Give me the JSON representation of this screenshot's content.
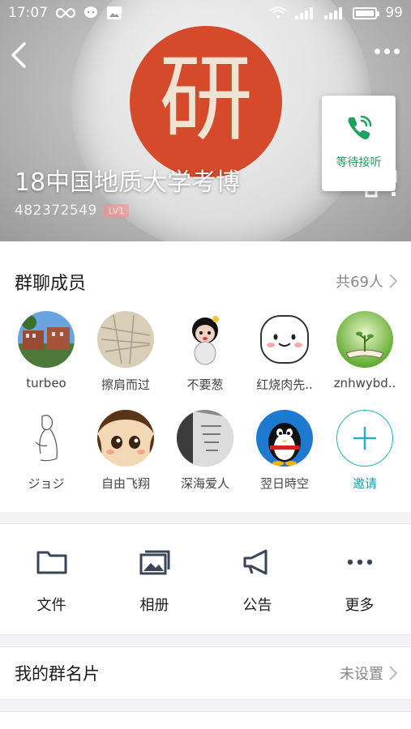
{
  "status": {
    "time": "17:07",
    "battery": "99",
    "icons": [
      "infinity-icon",
      "chat-bubble-icon",
      "gallery-icon",
      "wifi-icon",
      "signal-icon",
      "signal-4g-icon",
      "battery-icon"
    ]
  },
  "header": {
    "logo_char": "研",
    "group_name": "18中国地质大学考博",
    "group_id": "482372549",
    "level": "LV1",
    "call_label": "等待接听"
  },
  "members": {
    "title": "群聊成员",
    "count": "共69人",
    "list": [
      {
        "name": "turbeo"
      },
      {
        "name": "擦肩而过"
      },
      {
        "name": "不要葱"
      },
      {
        "name": "红烧肉先.."
      },
      {
        "name": "znhwybd.."
      },
      {
        "name": "ジョジ"
      },
      {
        "name": "自由飞翔"
      },
      {
        "name": "深海爱人"
      },
      {
        "name": "翌日時空"
      }
    ],
    "invite_label": "邀请"
  },
  "actions": [
    {
      "label": "文件",
      "icon": "folder-icon"
    },
    {
      "label": "相册",
      "icon": "photo-album-icon"
    },
    {
      "label": "公告",
      "icon": "megaphone-icon"
    },
    {
      "label": "更多",
      "icon": "more-icon"
    }
  ],
  "card_row": {
    "label": "我的群名片",
    "value": "未设置"
  },
  "colors": {
    "accent": "#24b0c8",
    "call_green": "#1aa260",
    "logo_red": "#d44a2b"
  }
}
